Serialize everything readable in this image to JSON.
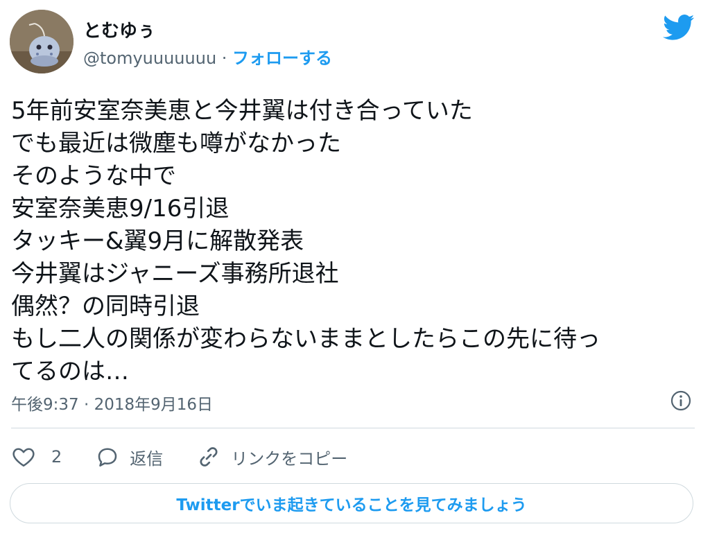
{
  "user": {
    "display_name": "とむゆぅ",
    "handle": "@tomyuuuuuuu",
    "separator": " · ",
    "follow_label": "フォローする",
    "avatar_icon": "avatar-toy-figure"
  },
  "brand": {
    "icon": "twitter-bird-icon",
    "color": "#1d9bf0"
  },
  "tweet": {
    "lines": [
      "5年前安室奈美恵と今井翼は付き合っていた",
      "でも最近は微塵も噂がなかった",
      "そのような中で",
      "安室奈美恵9/16引退",
      "タッキー&翼9月に解散発表",
      "今井翼はジャニーズ事務所退社",
      "偶然？の同時引退",
      "もし二人の関係が変わらないままとしたらこの先に待っ",
      "てるのは…"
    ],
    "timestamp": "午後9:37 · 2018年9月16日"
  },
  "actions": {
    "like_count": "2",
    "reply_label": "返信",
    "copy_link_label": "リンクをコピー"
  },
  "cta": {
    "label": "Twitterでいま起きていることを見てみましょう"
  },
  "colors": {
    "accent": "#1d9bf0",
    "text": "#0f1419",
    "muted": "#536471",
    "border": "#cfd9de"
  }
}
